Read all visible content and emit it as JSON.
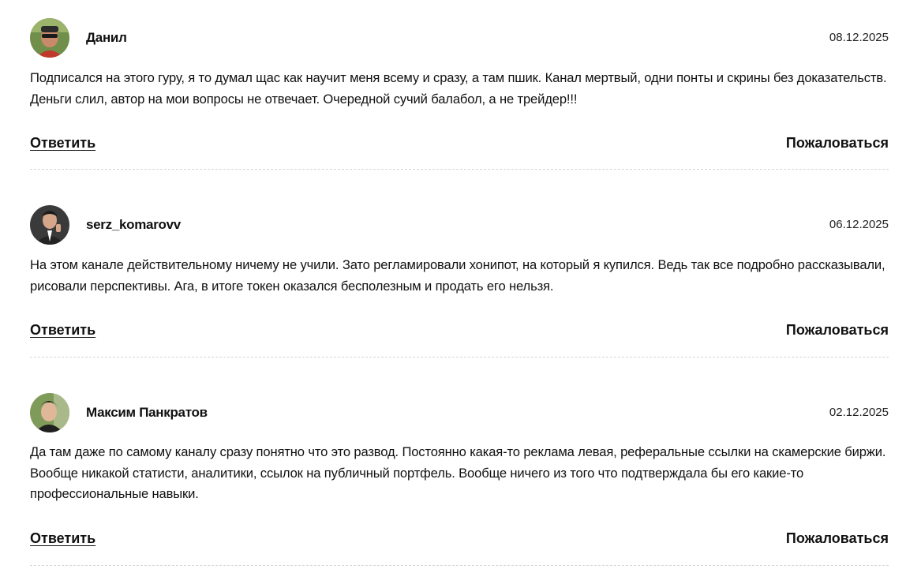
{
  "comments": [
    {
      "author": "Данил",
      "date": "08.12.2025",
      "text": "Подписался на этого гуру, я то думал щас как научит меня всему и сразу, а там пшик. Канал мертвый, одни понты и скрины без доказательств. Деньги слил, автор на мои вопросы не отвечает. Очередной сучий балабол, а не трейдер!!!",
      "reply_label": "Ответить",
      "report_label": "Пожаловаться",
      "avatar_icon": "avatar-photo-man-sunglasses"
    },
    {
      "author": "serz_komarovv",
      "date": "06.12.2025",
      "text": "На этом канале действительному ничему не учили. Зато регламировали хонипот, на который я купился. Ведь так все подробно рассказывали, рисовали перспективы. Ага, в итоге токен оказался бесполезным и продать его нельзя.",
      "reply_label": "Ответить",
      "report_label": "Пожаловаться",
      "avatar_icon": "avatar-photo-man-suit"
    },
    {
      "author": "Максим Панкратов",
      "date": "02.12.2025",
      "text": "Да там даже по самому каналу сразу понятно что это развод. Постоянно какая-то реклама левая, реферальные ссылки на скамерские биржи. Вообще никакой статисти, аналитики, ссылок на публичный портфель. Вообще ничего из того что подтверждала бы его какие-то профессиональные навыки.",
      "reply_label": "Ответить",
      "report_label": "Пожаловаться",
      "avatar_icon": "avatar-photo-young-man"
    }
  ]
}
